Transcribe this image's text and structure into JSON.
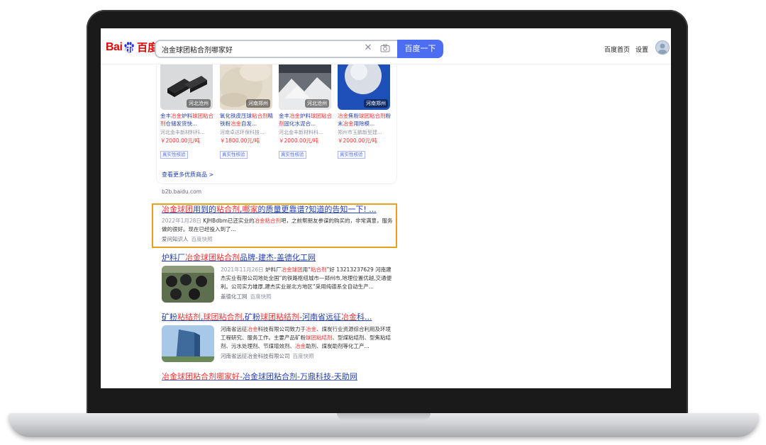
{
  "header": {
    "logo_latin": "Bai",
    "logo_du": "du",
    "logo_cn": "百度",
    "search_value": "冶金球团粘合剂哪家好",
    "search_button": "百度一下",
    "nav": [
      "百度首页",
      "设置"
    ]
  },
  "products": [
    {
      "region": "河北沧州",
      "title_a": "金丰",
      "title_hl1": "冶金",
      "title_b": "炉料",
      "title_hl2": "球团粘",
      "title_c": "合剂",
      "title_d": "仓储发货快...",
      "shop": "河北金丰新材料科...",
      "price": "￥2000.00元/吨",
      "verify": "真实性核验"
    },
    {
      "region": "河南郑州",
      "title_a": "氧化铁皮压球",
      "title_hl1": "粘合剂",
      "title_b": "",
      "title_hl2": "",
      "title_c": "精铁粉",
      "title_d": "冶金",
      "title_e": "自发...",
      "shop": "河南卓达环保科技...",
      "price": "￥1800.00元/吨",
      "verify": "真实性核验"
    },
    {
      "region": "河北沧州",
      "title_a": "金丰",
      "title_hl1": "冶金",
      "title_b": "炉料",
      "title_hl2": "球团粘",
      "title_c": "合剂",
      "title_d": "固化水泥合...",
      "shop": "河北金丰新材料科...",
      "price": "￥2000.00元/吨",
      "verify": "真实性核验"
    },
    {
      "region": "河南郑州",
      "title_a": "冶金",
      "title_hl1": "",
      "title_b": "焦粉",
      "title_hl2": "球团粘合剂",
      "title_c": "",
      "title_d": "粉末",
      "title_e": "冶金",
      "title_f": "用除模...",
      "shop": "郑州市玉鹏新型建...",
      "price": "￥2000.00元/吨",
      "verify": "真实性核验"
    }
  ],
  "more_products": "查看更多优质商品 >",
  "b2b_source": "b2b.baidu.com",
  "results": [
    {
      "title_hl1": "冶金球团",
      "title_a": "用到的",
      "title_hl2": "粘合剂",
      "title_b": ",",
      "title_hl3": "哪家",
      "title_c": "的质量更靠谱?知道的告知一下! ...",
      "date": "2022年1月28日",
      "desc_a": " KJHBdbm已还实业的",
      "desc_hl": "冶金粘合剂",
      "desc_b": "吧，之前帮朋友参谋的购买的，非常满意，服务做的很好。现在已经投入到了...",
      "source": "爱问知识人",
      "snapshot": "百度快照"
    },
    {
      "title_a": "炉料厂",
      "title_hl1": "冶金球团粘合剂",
      "title_b": "品牌-建杰-盖德化工网",
      "date": "2021年11月26日",
      "desc_a": " 炉料厂",
      "desc_hl": "冶金球团",
      "desc_b": "用“",
      "desc_hl2": "粘合剂",
      "desc_c": "”好 13213237629 河南建杰实业有限公司地处全国“的铁路枢纽城市—郑州市,地理位置优越,交通便利。公司实力雄厚,建杰实业是北方地区“采用纯德系全自动生产...",
      "source": "盖德化工网",
      "snapshot": "百度快照"
    },
    {
      "title_a": "矿粉",
      "title_hl1": "粘结剂",
      "title_b": ",",
      "title_hl2": "球团粘合剂",
      "title_c": ",矿粉",
      "title_hl3": "球团粘结剂",
      "title_d": "-河南省远征",
      "title_hl4": "冶金",
      "title_e": "科...",
      "desc_a": "河南省远征",
      "desc_hl": "冶金",
      "desc_b": "科技有限公司致力于",
      "desc_hl2": "冶金",
      "desc_c": "、煤炭行业资源综合利用及环境工程研究、服务工作。主要产品矿粉",
      "desc_hl3": "球团粘结剂",
      "desc_d": "、型煤粘结剂、型焦粘结剂、污水处理剂、节煤增效剂、",
      "desc_hl4": "冶金",
      "desc_e": "助剂、煤炭助剂等化工产...",
      "source": "河南省远征冶金科技有限公司",
      "snapshot": "百度快照"
    },
    {
      "title_hl1": "冶金球团粘合剂哪家好",
      "title_a": "-冶金球团粘合剂-万鼎科技-天助网"
    }
  ],
  "colors": {
    "link": "#2440b3",
    "highlight": "#f73131",
    "search_button": "#4e6ef2",
    "annotation_box": "#e7a11b"
  }
}
